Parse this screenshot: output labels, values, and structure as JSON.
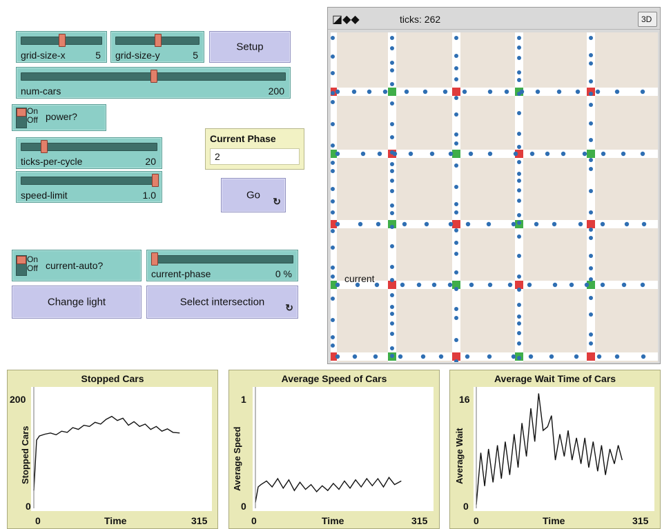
{
  "controls": {
    "grid_size_x": {
      "label": "grid-size-x",
      "value": "5",
      "fraction": 0.5
    },
    "grid_size_y": {
      "label": "grid-size-y",
      "value": "5",
      "fraction": 0.5
    },
    "setup_label": "Setup",
    "num_cars": {
      "label": "num-cars",
      "value": "200",
      "fraction": 0.5
    },
    "power": {
      "on": "On",
      "off": "Off",
      "label": "power?"
    },
    "current_phase_monitor": {
      "label": "Current Phase",
      "value": "2"
    },
    "ticks_per_cycle": {
      "label": "ticks-per-cycle",
      "value": "20",
      "fraction": 0.15
    },
    "speed_limit": {
      "label": "speed-limit",
      "value": "1.0",
      "fraction": 1.0
    },
    "go_label": "Go",
    "current_auto": {
      "on": "On",
      "off": "Off",
      "label": "current-auto?"
    },
    "current_phase_slider": {
      "label": "current-phase",
      "value": "0 %",
      "fraction": 0.0
    },
    "change_light_label": "Change light",
    "select_intersection_label": "Select intersection"
  },
  "world": {
    "ticks_label": "ticks: 262",
    "three_d_label": "3D",
    "current_text": "current",
    "colors": {
      "patch": "#ebe3d9",
      "road": "#ffffff",
      "light_red": "#e03c3c",
      "light_green": "#3fae49",
      "car": "#2f6fb3"
    }
  },
  "plots": [
    {
      "title": "Stopped Cars",
      "ylabel": "Stopped Cars",
      "xlabel": "Time",
      "xmin": "0",
      "xmax": "315",
      "ymin": "0",
      "ymax": "200",
      "ylim": [
        0,
        200
      ],
      "xlim": [
        0,
        315
      ]
    },
    {
      "title": "Average Speed of Cars",
      "ylabel": "Average Speed",
      "xlabel": "Time",
      "xmin": "0",
      "xmax": "315",
      "ymin": "0",
      "ymax": "1",
      "ylim": [
        0,
        1
      ],
      "xlim": [
        0,
        315
      ]
    },
    {
      "title": "Average Wait Time of Cars",
      "ylabel": "Average Wait",
      "xlabel": "Time",
      "xmin": "0",
      "xmax": "315",
      "ymin": "0",
      "ymax": "16",
      "ylim": [
        0,
        16
      ],
      "xlim": [
        0,
        315
      ]
    }
  ],
  "chart_data": [
    {
      "type": "line",
      "title": "Stopped Cars",
      "xlabel": "Time",
      "ylabel": "Stopped Cars",
      "xlim": [
        0,
        315
      ],
      "ylim": [
        0,
        200
      ],
      "x": [
        0,
        5,
        10,
        20,
        30,
        40,
        50,
        60,
        70,
        80,
        90,
        100,
        110,
        120,
        130,
        140,
        150,
        160,
        170,
        180,
        190,
        200,
        210,
        220,
        230,
        240,
        250,
        262
      ],
      "series": [
        {
          "values": [
            30,
            115,
            122,
            125,
            127,
            124,
            130,
            128,
            136,
            133,
            140,
            138,
            145,
            142,
            150,
            155,
            148,
            152,
            140,
            146,
            138,
            142,
            133,
            138,
            130,
            134,
            128,
            127
          ]
        }
      ]
    },
    {
      "type": "line",
      "title": "Average Speed of Cars",
      "xlabel": "Time",
      "ylabel": "Average Speed",
      "xlim": [
        0,
        315
      ],
      "ylim": [
        0,
        1
      ],
      "x": [
        0,
        5,
        10,
        20,
        30,
        40,
        50,
        60,
        70,
        80,
        90,
        100,
        110,
        120,
        130,
        140,
        150,
        160,
        170,
        180,
        190,
        200,
        210,
        220,
        230,
        240,
        250,
        262
      ],
      "series": [
        {
          "values": [
            0.05,
            0.18,
            0.2,
            0.23,
            0.18,
            0.25,
            0.17,
            0.24,
            0.15,
            0.22,
            0.16,
            0.2,
            0.14,
            0.19,
            0.15,
            0.21,
            0.16,
            0.23,
            0.17,
            0.24,
            0.18,
            0.25,
            0.19,
            0.25,
            0.18,
            0.26,
            0.2,
            0.23
          ]
        }
      ]
    },
    {
      "type": "line",
      "title": "Average Wait Time of Cars",
      "xlabel": "Time",
      "ylabel": "Average Wait",
      "xlim": [
        0,
        315
      ],
      "ylim": [
        0,
        16
      ],
      "x": [
        0,
        8,
        15,
        22,
        30,
        38,
        45,
        52,
        60,
        68,
        75,
        82,
        90,
        98,
        105,
        112,
        120,
        128,
        135,
        142,
        150,
        158,
        165,
        172,
        180,
        188,
        195,
        202,
        210,
        218,
        225,
        232,
        240,
        248,
        255,
        262
      ],
      "series": [
        {
          "values": [
            0.5,
            7.5,
            3,
            8,
            3.5,
            8.5,
            4,
            9,
            4.5,
            10,
            5.5,
            11.5,
            7,
            13.5,
            9,
            15.5,
            10.5,
            11,
            12.5,
            6.5,
            10,
            7,
            10.5,
            6.5,
            9.5,
            6,
            9.5,
            5.5,
            9,
            5,
            8.5,
            4.5,
            8,
            6,
            8.5,
            6.5
          ]
        }
      ]
    }
  ]
}
